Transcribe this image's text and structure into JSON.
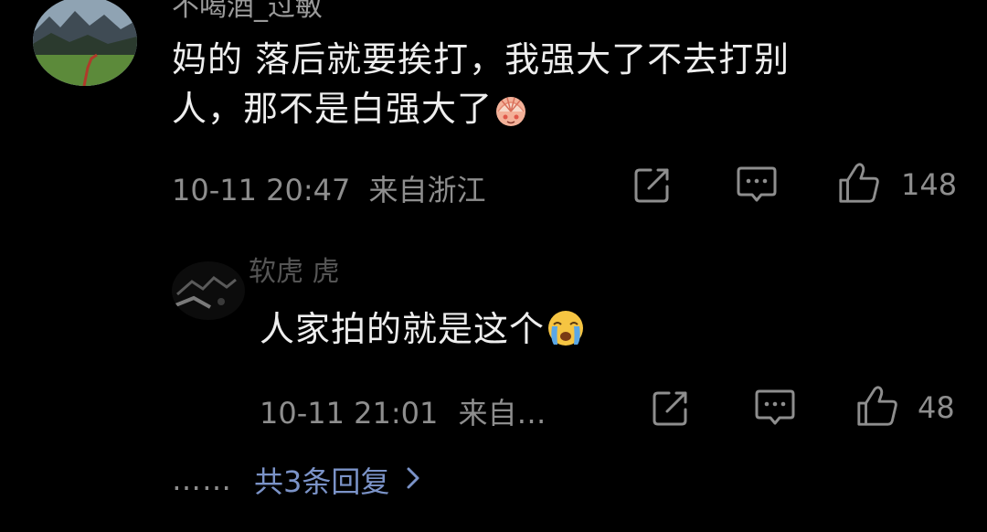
{
  "comment": {
    "username": "不喝酒_过敏",
    "text_line1": "妈的 落后就要挨打，我强大了不去打别",
    "text_line2": "人，那不是白强大了",
    "emoji_name": "fan-blush-emoji",
    "timestamp": "10-11 20:47",
    "location": "来自浙江",
    "like_count": "148"
  },
  "reply": {
    "username": "软虎 虎",
    "text": "人家拍的就是这个",
    "emoji_name": "crying-face-emoji",
    "timestamp": "10-11 21:01",
    "location": "来自…",
    "like_count": "48"
  },
  "more_replies": {
    "dots": "……",
    "label": "共3条回复",
    "chevron_icon": "chevron-right-icon"
  },
  "colors": {
    "background": "#000000",
    "text_primary": "#eeeeee",
    "text_secondary": "#8e8e8e",
    "link": "#7b93c8"
  },
  "icons": [
    "share-icon",
    "comment-icon",
    "thumbs-up-icon"
  ]
}
